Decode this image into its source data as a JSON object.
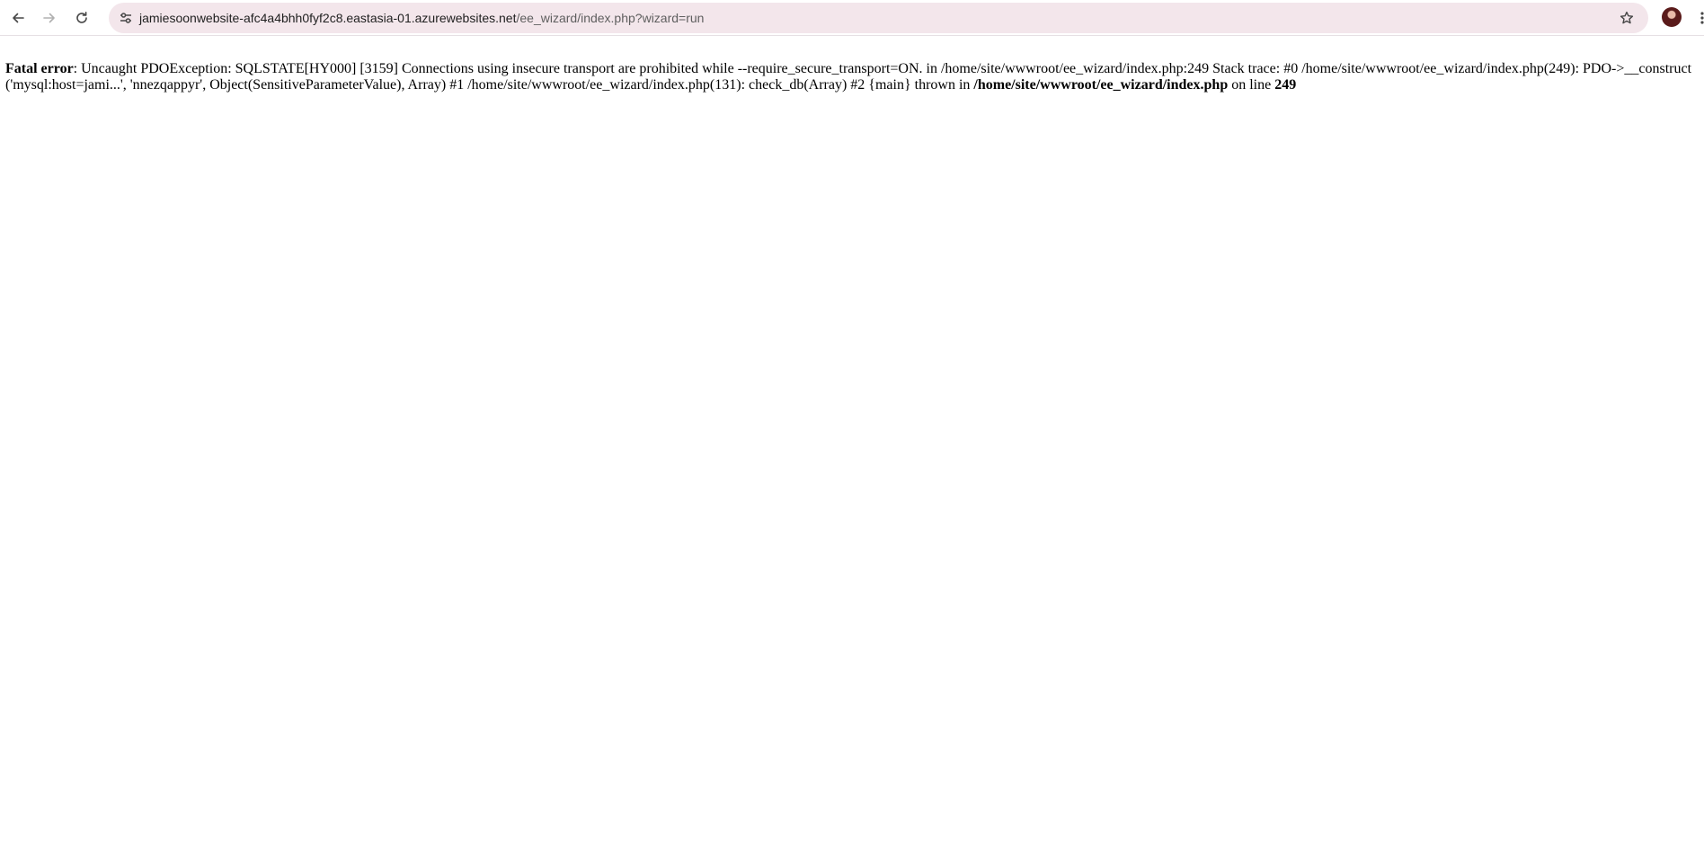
{
  "browser": {
    "url_domain": "jamiesoonwebsite-afc4a4bhh0fyf2c8.eastasia-01.azurewebsites.net",
    "url_path": "/ee_wizard/index.php?wizard=run"
  },
  "error": {
    "label": "Fatal error",
    "message": ": Uncaught PDOException: SQLSTATE[HY000] [3159] Connections using insecure transport are prohibited while --require_secure_transport=ON. in /home/site/wwwroot/ee_wizard/index.php:249 Stack trace: #0 /home/site/wwwroot/ee_wizard/index.php(249): PDO->__construct('mysql:host=jami...', 'nnezqappyr', Object(SensitiveParameterValue), Array) #1 /home/site/wwwroot/ee_wizard/index.php(131): check_db(Array) #2 {main} thrown in ",
    "file": "/home/site/wwwroot/ee_wizard/index.php",
    "line_prefix": " on line ",
    "line": "249"
  },
  "colors": {
    "omnibox_bg": "#f3e6eb",
    "icon": "#474747",
    "icon_disabled": "#b0b0b0"
  }
}
